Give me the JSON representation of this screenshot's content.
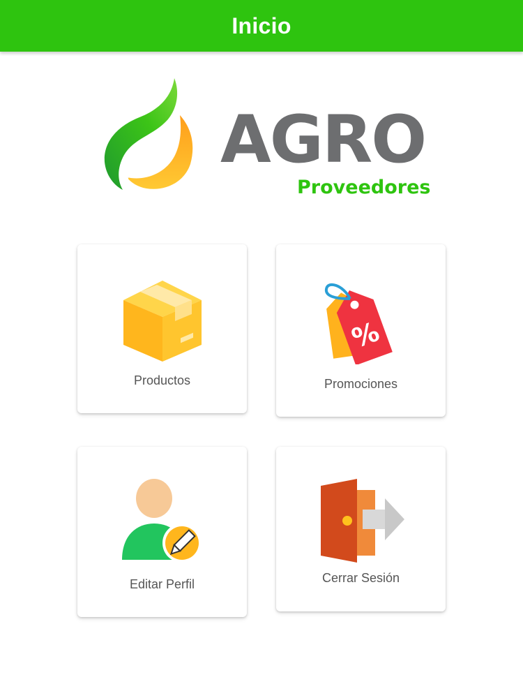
{
  "appbar": {
    "title": "Inicio",
    "color": "#2ec40f"
  },
  "logo": {
    "word": "AGRO",
    "subtitle": "Proveedores",
    "word_color": "#6d6e70",
    "subtitle_color": "#2ec40f"
  },
  "menu": {
    "productos": {
      "label": "Productos",
      "icon": "box-icon"
    },
    "promociones": {
      "label": "Promociones",
      "icon": "discount-tag-icon"
    },
    "editar_perfil": {
      "label": "Editar Perfil",
      "icon": "user-edit-icon"
    },
    "cerrar_sesion": {
      "label": "Cerrar Sesión",
      "icon": "logout-door-icon"
    }
  }
}
